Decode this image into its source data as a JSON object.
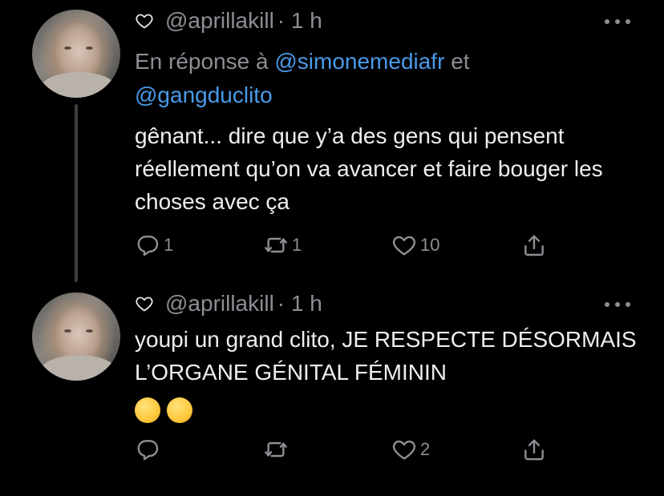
{
  "tweets": [
    {
      "handle": "@aprillakill",
      "time": "· 1 h",
      "reply_prefix": "En réponse à",
      "reply_mention_1": "@simonemediafr",
      "reply_conj": "et",
      "reply_mention_2": "@gangduclito",
      "text": "gênant... dire que y’a des gens qui pensent réellement qu’on va avancer et faire bouger les choses avec ça",
      "replies": "1",
      "retweets": "1",
      "likes": "10"
    },
    {
      "handle": "@aprillakill",
      "time": "· 1 h",
      "text": "youpi un grand clito, JE RESPECTE DÉSORMAIS L’ORGANE GÉNITAL FÉMININ",
      "emojis": [
        "grinning-squinting-face",
        "star-struck-face"
      ],
      "replies": "",
      "retweets": "",
      "likes": "2"
    }
  ],
  "colors": {
    "background": "#000000",
    "text": "#eceff1",
    "muted": "#8b8f94",
    "mention": "#4a9ae8"
  }
}
